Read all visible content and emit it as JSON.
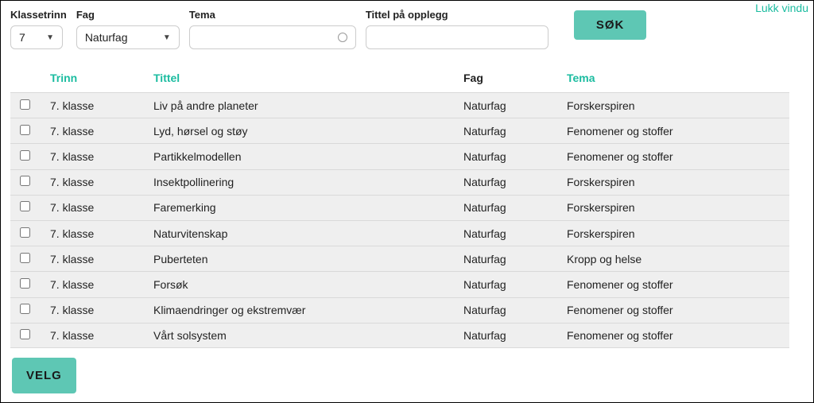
{
  "close_link": "Lukk vindu",
  "filters": {
    "klassetrinn": {
      "label": "Klassetrinn",
      "value": "7"
    },
    "fag": {
      "label": "Fag",
      "value": "Naturfag"
    },
    "tema": {
      "label": "Tema",
      "value": ""
    },
    "tittel": {
      "label": "Tittel på opplegg",
      "value": ""
    }
  },
  "buttons": {
    "search": "SØK",
    "select": "VELG"
  },
  "table": {
    "headers": {
      "trinn": "Trinn",
      "tittel": "Tittel",
      "fag": "Fag",
      "tema": "Tema"
    },
    "rows": [
      {
        "trinn": "7. klasse",
        "tittel": "Liv på andre planeter",
        "fag": "Naturfag",
        "tema": "Forskerspiren"
      },
      {
        "trinn": "7. klasse",
        "tittel": "Lyd, hørsel og støy",
        "fag": "Naturfag",
        "tema": "Fenomener og stoffer"
      },
      {
        "trinn": "7. klasse",
        "tittel": "Partikkelmodellen",
        "fag": "Naturfag",
        "tema": "Fenomener og stoffer"
      },
      {
        "trinn": "7. klasse",
        "tittel": "Insektpollinering",
        "fag": "Naturfag",
        "tema": "Forskerspiren"
      },
      {
        "trinn": "7. klasse",
        "tittel": "Faremerking",
        "fag": "Naturfag",
        "tema": "Forskerspiren"
      },
      {
        "trinn": "7. klasse",
        "tittel": "Naturvitenskap",
        "fag": "Naturfag",
        "tema": "Forskerspiren"
      },
      {
        "trinn": "7. klasse",
        "tittel": "Puberteten",
        "fag": "Naturfag",
        "tema": "Kropp og helse"
      },
      {
        "trinn": "7. klasse",
        "tittel": "Forsøk",
        "fag": "Naturfag",
        "tema": "Fenomener og stoffer"
      },
      {
        "trinn": "7. klasse",
        "tittel": "Klimaendringer og ekstremvær",
        "fag": "Naturfag",
        "tema": "Fenomener og stoffer"
      },
      {
        "trinn": "7. klasse",
        "tittel": "Vårt solsystem",
        "fag": "Naturfag",
        "tema": "Fenomener og stoffer"
      }
    ]
  }
}
